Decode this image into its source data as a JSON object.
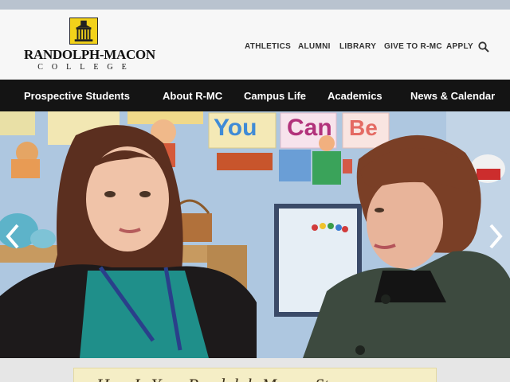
{
  "logo": {
    "name": "Randolph-Macon",
    "sub": "College"
  },
  "utility_nav": [
    {
      "label": "ATHLETICS"
    },
    {
      "label": "ALUMNI"
    },
    {
      "label": "LIBRARY"
    },
    {
      "label": "GIVE TO R-MC"
    },
    {
      "label": "APPLY"
    }
  ],
  "main_nav": [
    {
      "label": "Prospective Students"
    },
    {
      "label": "About R-MC"
    },
    {
      "label": "Campus Life"
    },
    {
      "label": "Academics"
    },
    {
      "label": "News & Calendar"
    }
  ],
  "hero": {
    "wall_words": [
      "You",
      "Can",
      "Be"
    ]
  },
  "caption": {
    "text": "How Is Your Randolph-Macon Story"
  },
  "colors": {
    "nav_bg": "#141414",
    "header_bg": "#f7f7f7",
    "logo_gold": "#f3d21a",
    "caption_bg": "#f5eec6"
  },
  "icons": {
    "search": "search-icon",
    "prev": "chevron-left-icon",
    "next": "chevron-right-icon"
  }
}
